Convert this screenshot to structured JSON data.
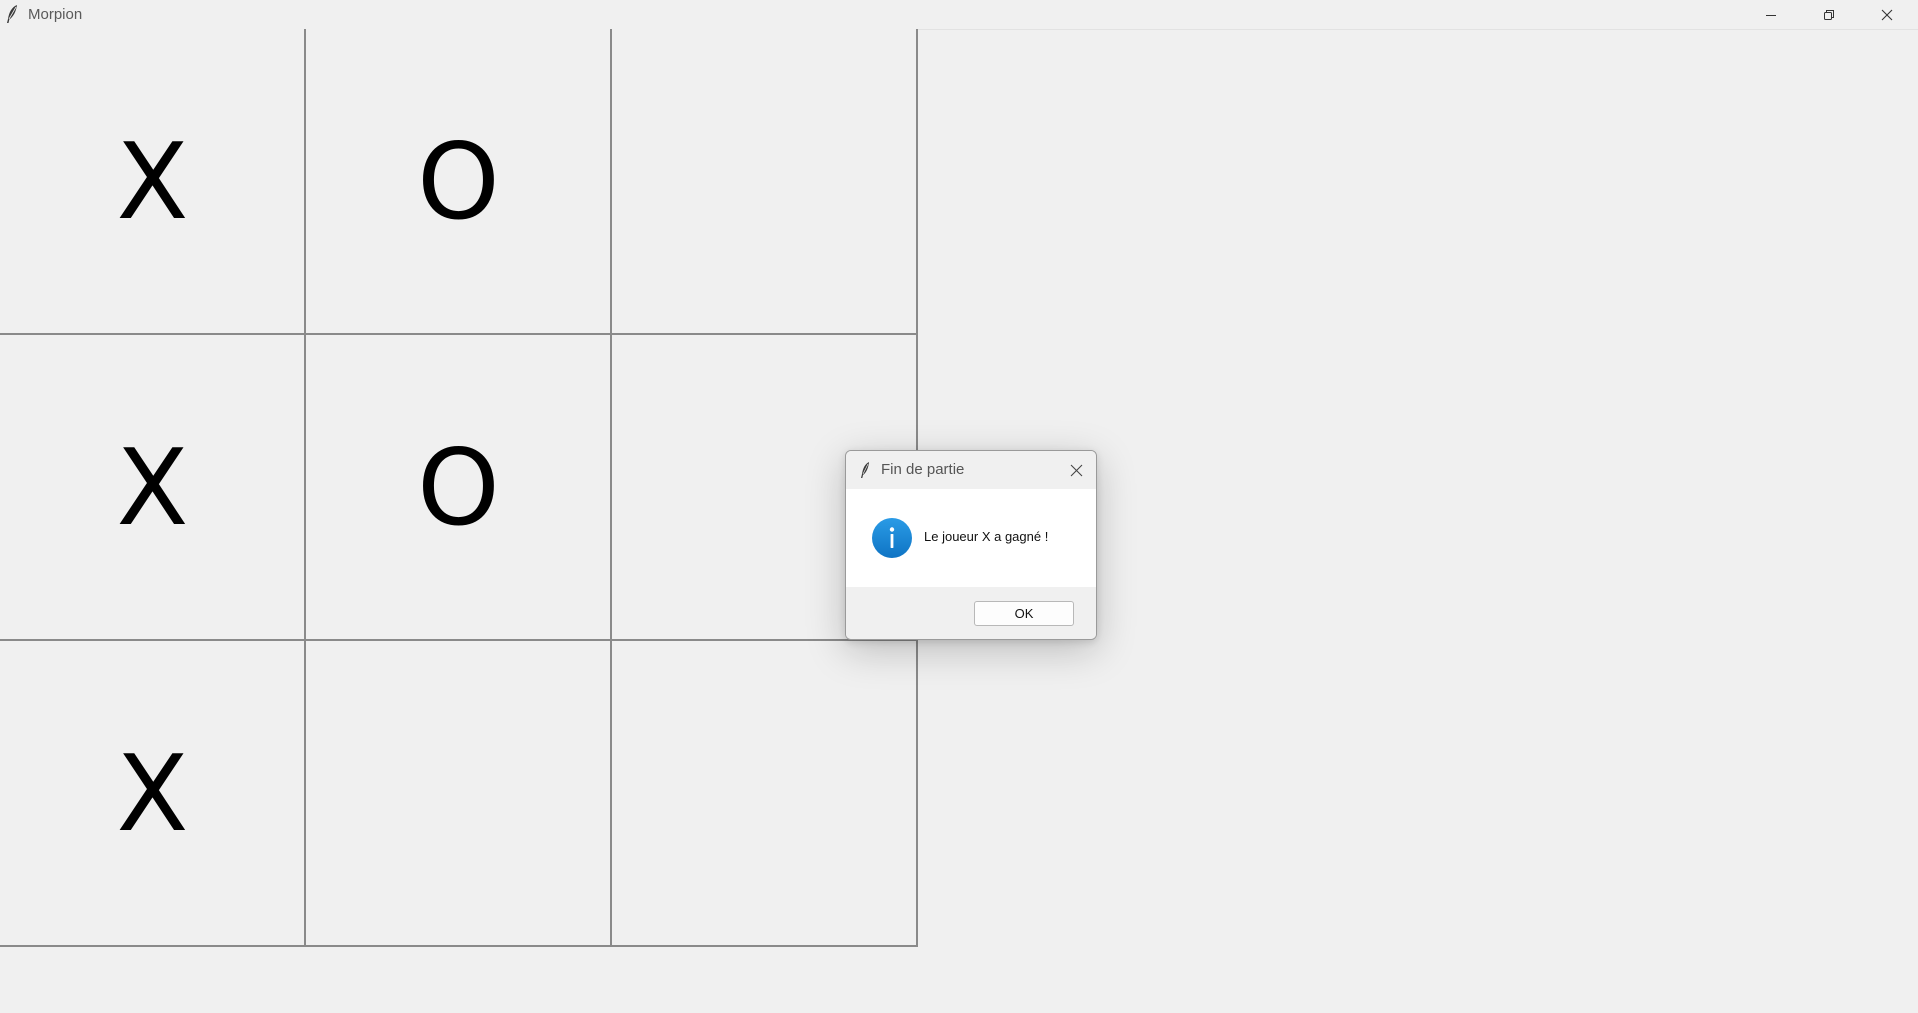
{
  "window": {
    "title": "Morpion",
    "app_icon": "feather-icon",
    "controls": {
      "minimize_icon": "minimize-icon",
      "maximize_icon": "restore-icon",
      "close_icon": "close-icon"
    }
  },
  "board": {
    "cells": [
      [
        "X",
        "O",
        ""
      ],
      [
        "X",
        "O",
        ""
      ],
      [
        "X",
        "",
        ""
      ]
    ]
  },
  "dialog": {
    "title": "Fin de partie",
    "app_icon": "feather-icon",
    "close_icon": "close-icon",
    "info_icon": "info-icon",
    "message": "Le joueur X a gagné !",
    "ok_label": "OK",
    "accent_color": "#1a8ad8"
  }
}
